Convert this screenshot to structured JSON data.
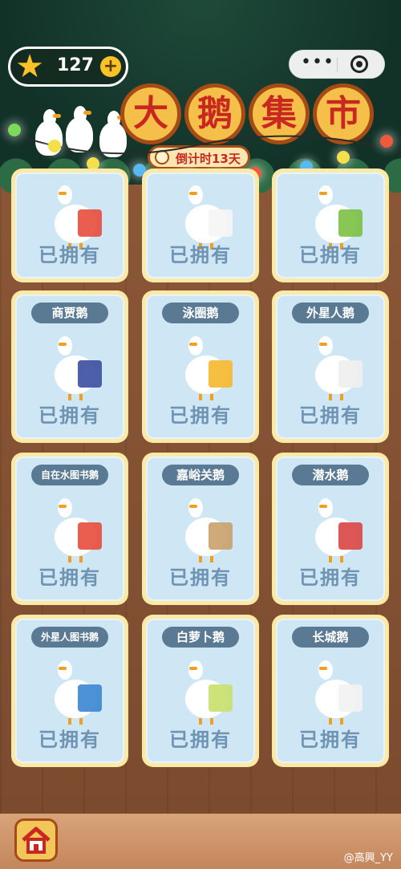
{
  "currency": {
    "count": "127",
    "plus": "+",
    "icon": "star-icon"
  },
  "miniprogram_capsule": {
    "more": "•••",
    "close_icon": "target-icon"
  },
  "title": {
    "chars": [
      "大",
      "鹅",
      "集",
      "市"
    ]
  },
  "countdown": {
    "text": "倒计时13天"
  },
  "owned_label": "已拥有",
  "cards": [
    {
      "name": "",
      "art": "box-goose-icon"
    },
    {
      "name": "",
      "art": "bottle-goose-icon"
    },
    {
      "name": "",
      "art": "green-goose-icon"
    },
    {
      "name": "商贾鹅",
      "art": "merchant-goose-icon"
    },
    {
      "name": "泳圈鹅",
      "art": "swim-ring-goose-icon"
    },
    {
      "name": "外星人鹅",
      "art": "alien-goose-icon"
    },
    {
      "name": "自在水图书鹅",
      "art": "book-goose-icon"
    },
    {
      "name": "嘉峪关鹅",
      "art": "jiayuguan-goose-icon"
    },
    {
      "name": "潜水鹅",
      "art": "diving-goose-icon"
    },
    {
      "name": "外星人图书鹅",
      "art": "alien-book-goose-icon"
    },
    {
      "name": "白萝卜鹅",
      "art": "radish-goose-icon"
    },
    {
      "name": "长城鹅",
      "art": "great-wall-goose-icon"
    }
  ],
  "bottom": {
    "home_icon": "home-icon",
    "watermark": "@高興_YY"
  },
  "colors": {
    "banner": "#123228",
    "gold": "#f5c04a",
    "title_red": "#c8281f",
    "card_blue": "#cfe7f5",
    "tag": "#5a7a93"
  }
}
